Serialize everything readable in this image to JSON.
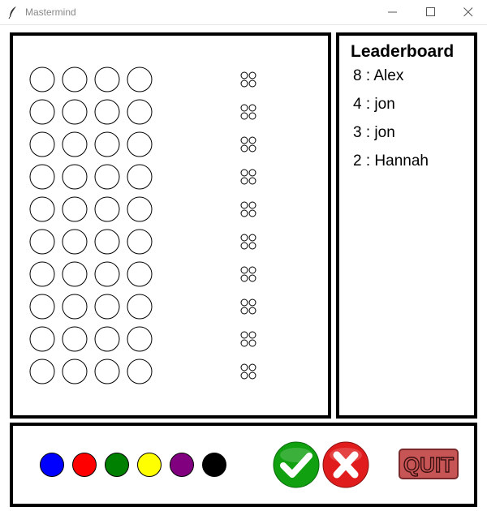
{
  "window": {
    "title": "Mastermind"
  },
  "board": {
    "rows": 10,
    "pegs_per_row": 4,
    "feedback_pegs_per_row": 4
  },
  "leaderboard": {
    "title": "Leaderboard",
    "entries": [
      {
        "score": 8,
        "name": "Alex",
        "text": "8 : Alex"
      },
      {
        "score": 4,
        "name": "jon",
        "text": "4 : jon"
      },
      {
        "score": 3,
        "name": "jon",
        "text": "3 : jon"
      },
      {
        "score": 2,
        "name": "Hannah",
        "text": "2 : Hannah"
      }
    ]
  },
  "palette": {
    "colors": [
      {
        "name": "blue",
        "hex": "#0000ff"
      },
      {
        "name": "red",
        "hex": "#ff0000"
      },
      {
        "name": "green",
        "hex": "#008000"
      },
      {
        "name": "yellow",
        "hex": "#ffff00"
      },
      {
        "name": "purple",
        "hex": "#800080"
      },
      {
        "name": "black",
        "hex": "#000000"
      }
    ]
  },
  "buttons": {
    "confirm": {
      "icon": "checkmark-icon",
      "color": "#10a010"
    },
    "clear": {
      "icon": "x-icon",
      "color": "#e01c1c"
    },
    "quit": {
      "label": "QUIT",
      "color": "#c85555"
    }
  }
}
